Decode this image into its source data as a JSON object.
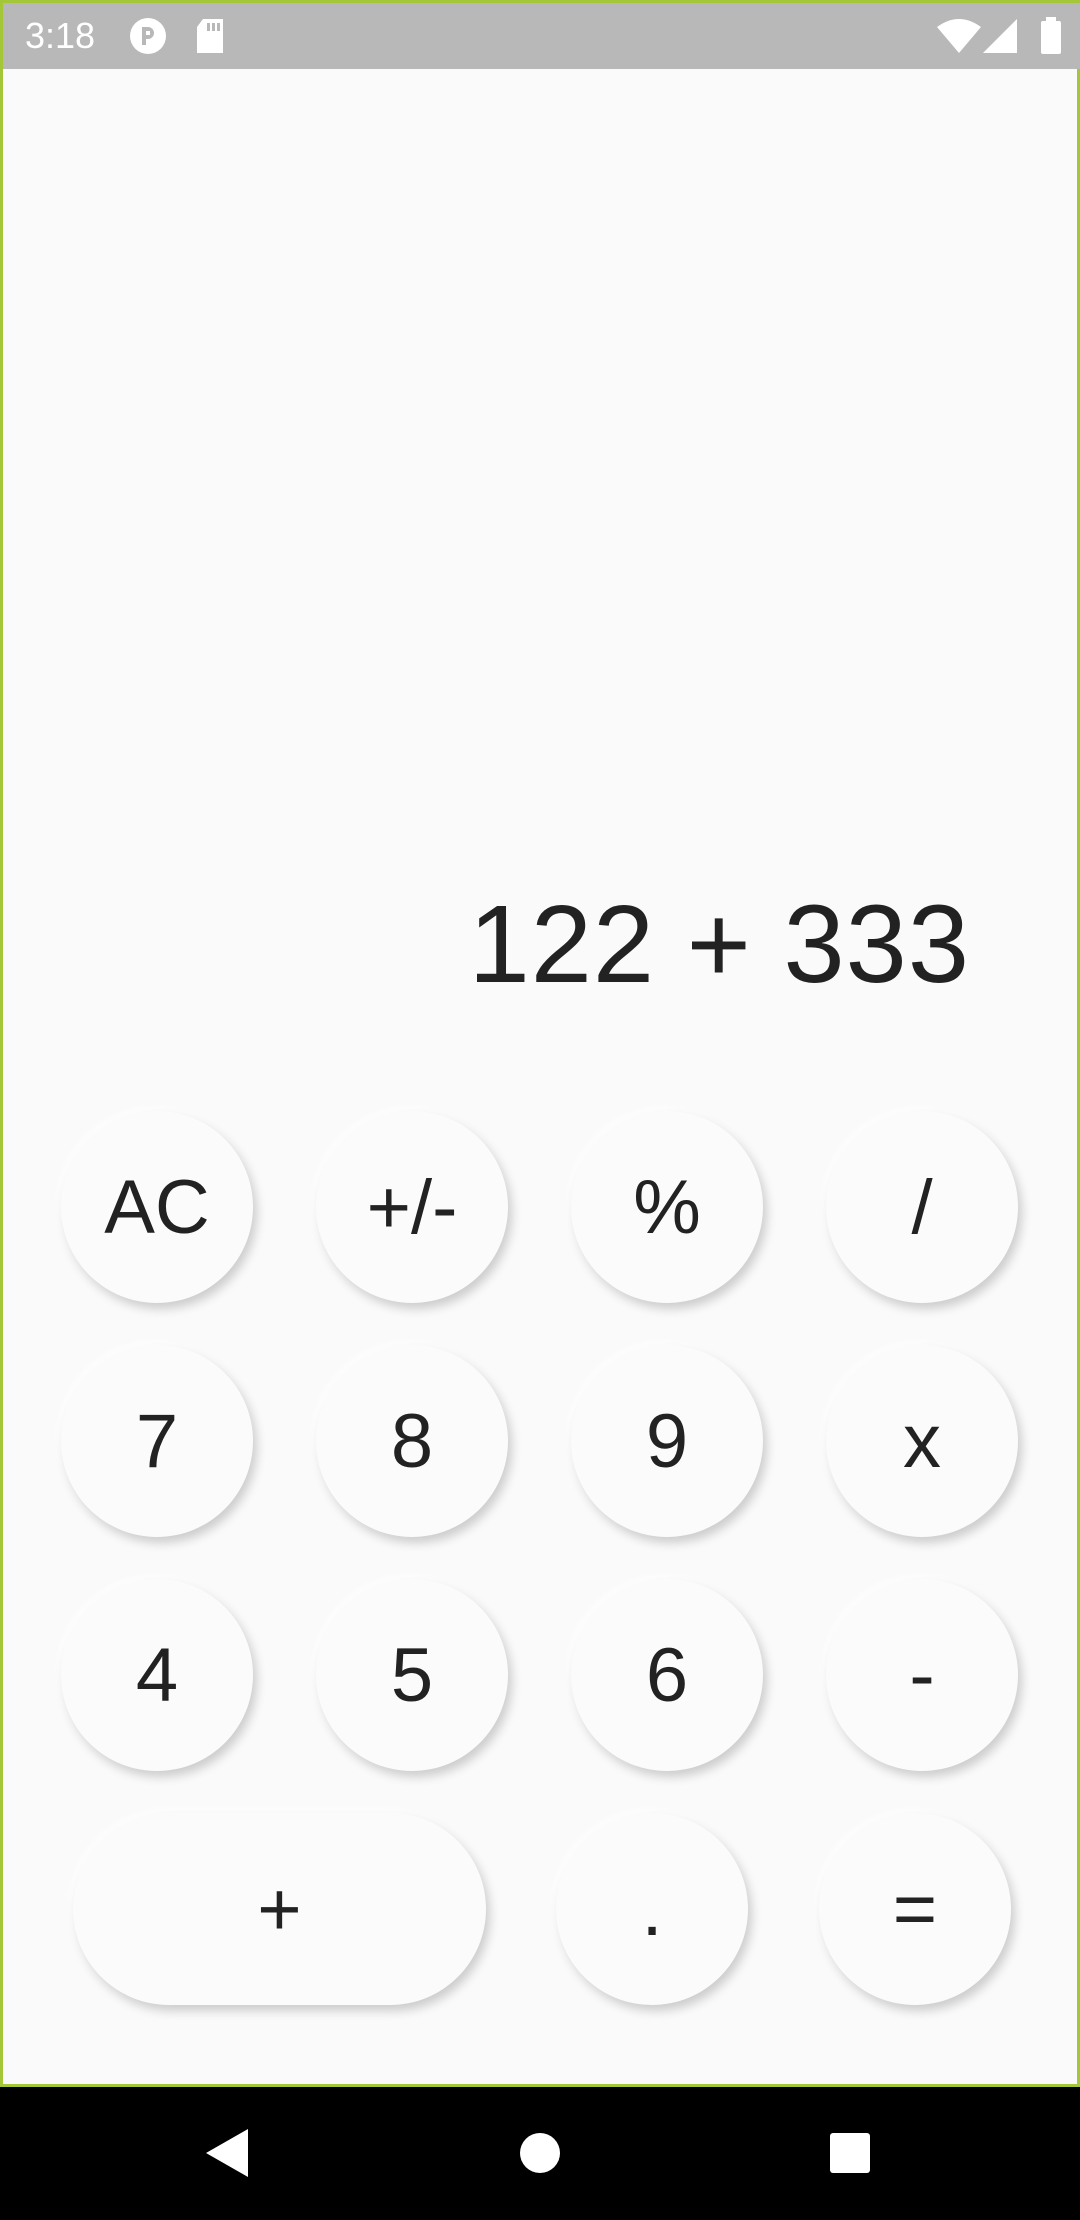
{
  "status_bar": {
    "time": "3:18",
    "icons": [
      "app-notification-icon",
      "sd-card-icon",
      "wifi-icon",
      "signal-icon",
      "battery-icon"
    ]
  },
  "display": {
    "expression": "122 + 333"
  },
  "keys": {
    "ac": "AC",
    "plus_minus": "+/-",
    "percent": "%",
    "divide": "/",
    "seven": "7",
    "eight": "8",
    "nine": "9",
    "multiply": "x",
    "four": "4",
    "five": "5",
    "six": "6",
    "minus": "-",
    "plus": "+",
    "decimal": ".",
    "equals": "="
  },
  "nav_bar": {
    "icons": [
      "back-icon",
      "home-icon",
      "recents-icon"
    ]
  },
  "colors": {
    "background": "#fafafa",
    "key_fill": "#fbfbfb",
    "text": "#222222",
    "frame_accent": "#a4c639",
    "status_bar": "#b8b8b8"
  }
}
